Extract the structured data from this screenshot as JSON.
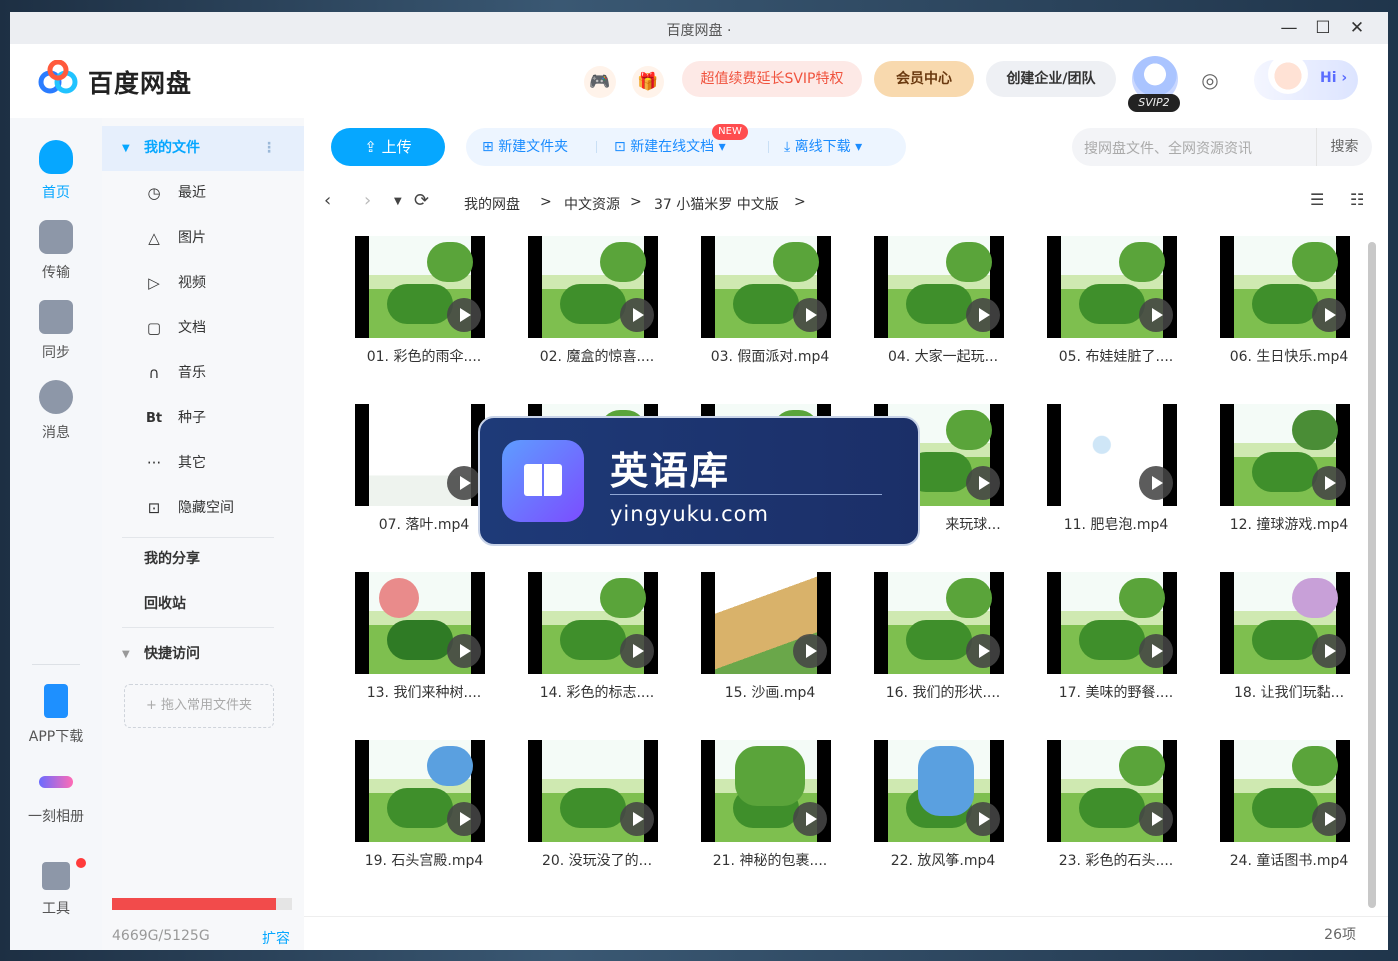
{
  "window": {
    "title": "百度网盘 ·"
  },
  "header": {
    "logo_text": "百度网盘",
    "promo": "超值续费延长SVIP特权",
    "member_center": "会员中心",
    "create_team": "创建企业/团队",
    "svip_badge": "SVIP2",
    "greeting": "Hi ›"
  },
  "left_nav": [
    {
      "label": "首页",
      "icon": "cloud-home-icon"
    },
    {
      "label": "传输",
      "icon": "transfer-icon"
    },
    {
      "label": "同步",
      "icon": "sync-icon"
    },
    {
      "label": "消息",
      "icon": "message-icon"
    },
    {
      "label": "APP下载",
      "icon": "phone-icon"
    },
    {
      "label": "一刻相册",
      "icon": "album-icon"
    },
    {
      "label": "工具",
      "icon": "tools-icon"
    }
  ],
  "sidebar": {
    "my_files": "我的文件",
    "items": [
      {
        "label": "最近",
        "icon": "clock-icon"
      },
      {
        "label": "图片",
        "icon": "image-icon"
      },
      {
        "label": "视频",
        "icon": "video-icon"
      },
      {
        "label": "文档",
        "icon": "document-icon"
      },
      {
        "label": "音乐",
        "icon": "headphones-icon"
      },
      {
        "label": "种子",
        "icon": "bt-icon"
      },
      {
        "label": "其它",
        "icon": "more-icon"
      },
      {
        "label": "隐藏空间",
        "icon": "lock-icon"
      }
    ],
    "my_share": "我的分享",
    "recycle_bin": "回收站",
    "quick_access": "快捷访问",
    "drop_hint": "+ 拖入常用文件夹",
    "quota_text": "4669G/5125G",
    "quota_fraction": 0.911,
    "expand": "扩容"
  },
  "toolbar": {
    "upload": "上传",
    "new_folder": "新建文件夹",
    "new_doc": "新建在线文档",
    "new_tag": "NEW",
    "offline_download": "离线下载",
    "search_placeholder": "搜网盘文件、全网资源资讯",
    "search_button": "搜索"
  },
  "breadcrumb": [
    "我的网盘",
    "中文资源",
    "37 小猫米罗 中文版"
  ],
  "files": [
    "01. 彩色的雨伞....",
    "02. 魔盒的惊喜....",
    "03. 假面派对.mp4",
    "04. 大家一起玩...",
    "05. 布娃娃脏了....",
    "06. 生日快乐.mp4",
    "07. 落叶.mp4",
    "",
    "",
    "来玩球...",
    "11. 肥皂泡.mp4",
    "12. 撞球游戏.mp4",
    "13. 我们来种树....",
    "14. 彩色的标志....",
    "15. 沙画.mp4",
    "16. 我们的形状....",
    "17. 美味的野餐....",
    "18. 让我们玩黏...",
    "19. 石头宫殿.mp4",
    "20. 没玩没了的...",
    "21. 神秘的包裹....",
    "22. 放风筝.mp4",
    "23. 彩色的石头....",
    "24. 童话图书.mp4"
  ],
  "overlay": {
    "title": "英语库",
    "url": "yingyuku.com"
  },
  "item_count": "26项"
}
